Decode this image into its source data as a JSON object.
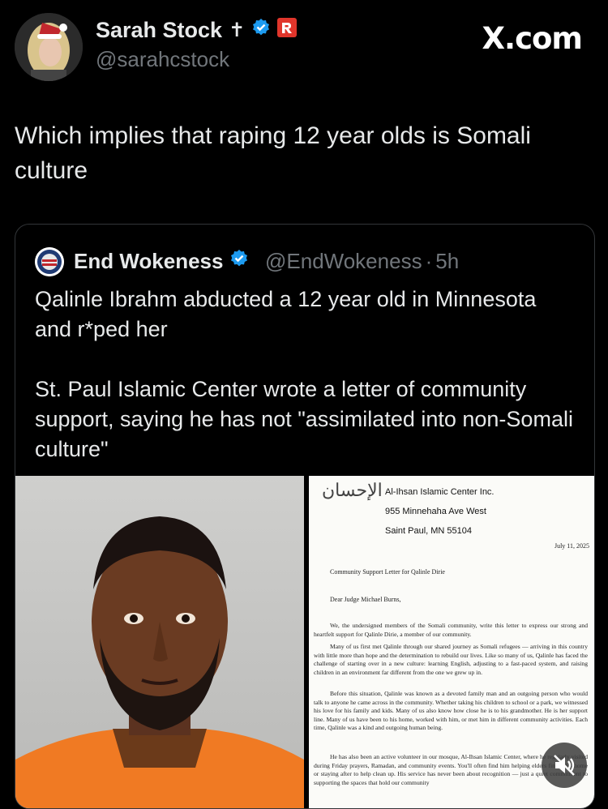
{
  "author": {
    "name": "Sarah Stock",
    "cross_glyph": "✝",
    "handle": "@sarahcstock",
    "icons": [
      "verified-badge-icon",
      "rumble-badge-icon"
    ]
  },
  "brand": {
    "site": "X.com"
  },
  "tweet": {
    "text": "Which implies that raping 12 year olds is Somali culture"
  },
  "quoted": {
    "name": "End Wokeness",
    "handle": "@EndWokeness",
    "separator": "·",
    "time": "5h",
    "paragraph1": "Qalinle Ibrahm abducted a 12 year old in Minnesota and r*ped her",
    "paragraph2": "St. Paul Islamic Center wrote a letter of community support, saying he has not \"assimilated into non-Somali culture\""
  },
  "letter": {
    "arabic_logo": "الإحسان",
    "org": "Al-Ihsan Islamic Center Inc.",
    "street": "955 Minnehaha Ave West",
    "city": "Saint Paul, MN 55104",
    "date": "July 11, 2025",
    "subject": "Community Support Letter for Qalinle Dirie",
    "salutation": "Dear Judge Michael Burns,",
    "p1": "We, the undersigned members of the Somali community, write this letter to express our strong and heartfelt support for Qalinle Dirie, a member of our community.",
    "p2": "Many of us first met Qalinle through our shared journey as Somali refugees — arriving in this country with little more than hope and the determination to rebuild our lives. Like so many of us, Qalinle has faced the challenge of starting over in a new culture: learning English, adjusting to a fast-paced system, and raising children in an environment far different from the one we grew up in.",
    "p3": "Before this situation, Qalinle was known as a devoted family man and an outgoing person who would talk to anyone he came across in the community. Whether taking his children to school or a park, we witnessed his love for his family and kids. Many of us also know how close he is to his grandmother. He is her support line. Many of us have been to his home, worked with him, or met him in different community activities. Each time, Qalinle was a kind and outgoing human being.",
    "p4": "He has also been an active volunteer in our mosque, Al-Ihsan Islamic Center, where he regularly visited during Friday prayers, Ramadan, and community events. You'll often find him helping elders find rides home or staying after to help clean up. His service has never been about recognition — just a quiet commitment to supporting the spaces that hold our community"
  },
  "colors": {
    "background": "#000000",
    "text": "#e7e9ea",
    "muted": "#71767b",
    "verified": "#1d9bf0",
    "rumble": "#e0352b",
    "border": "#333639"
  }
}
